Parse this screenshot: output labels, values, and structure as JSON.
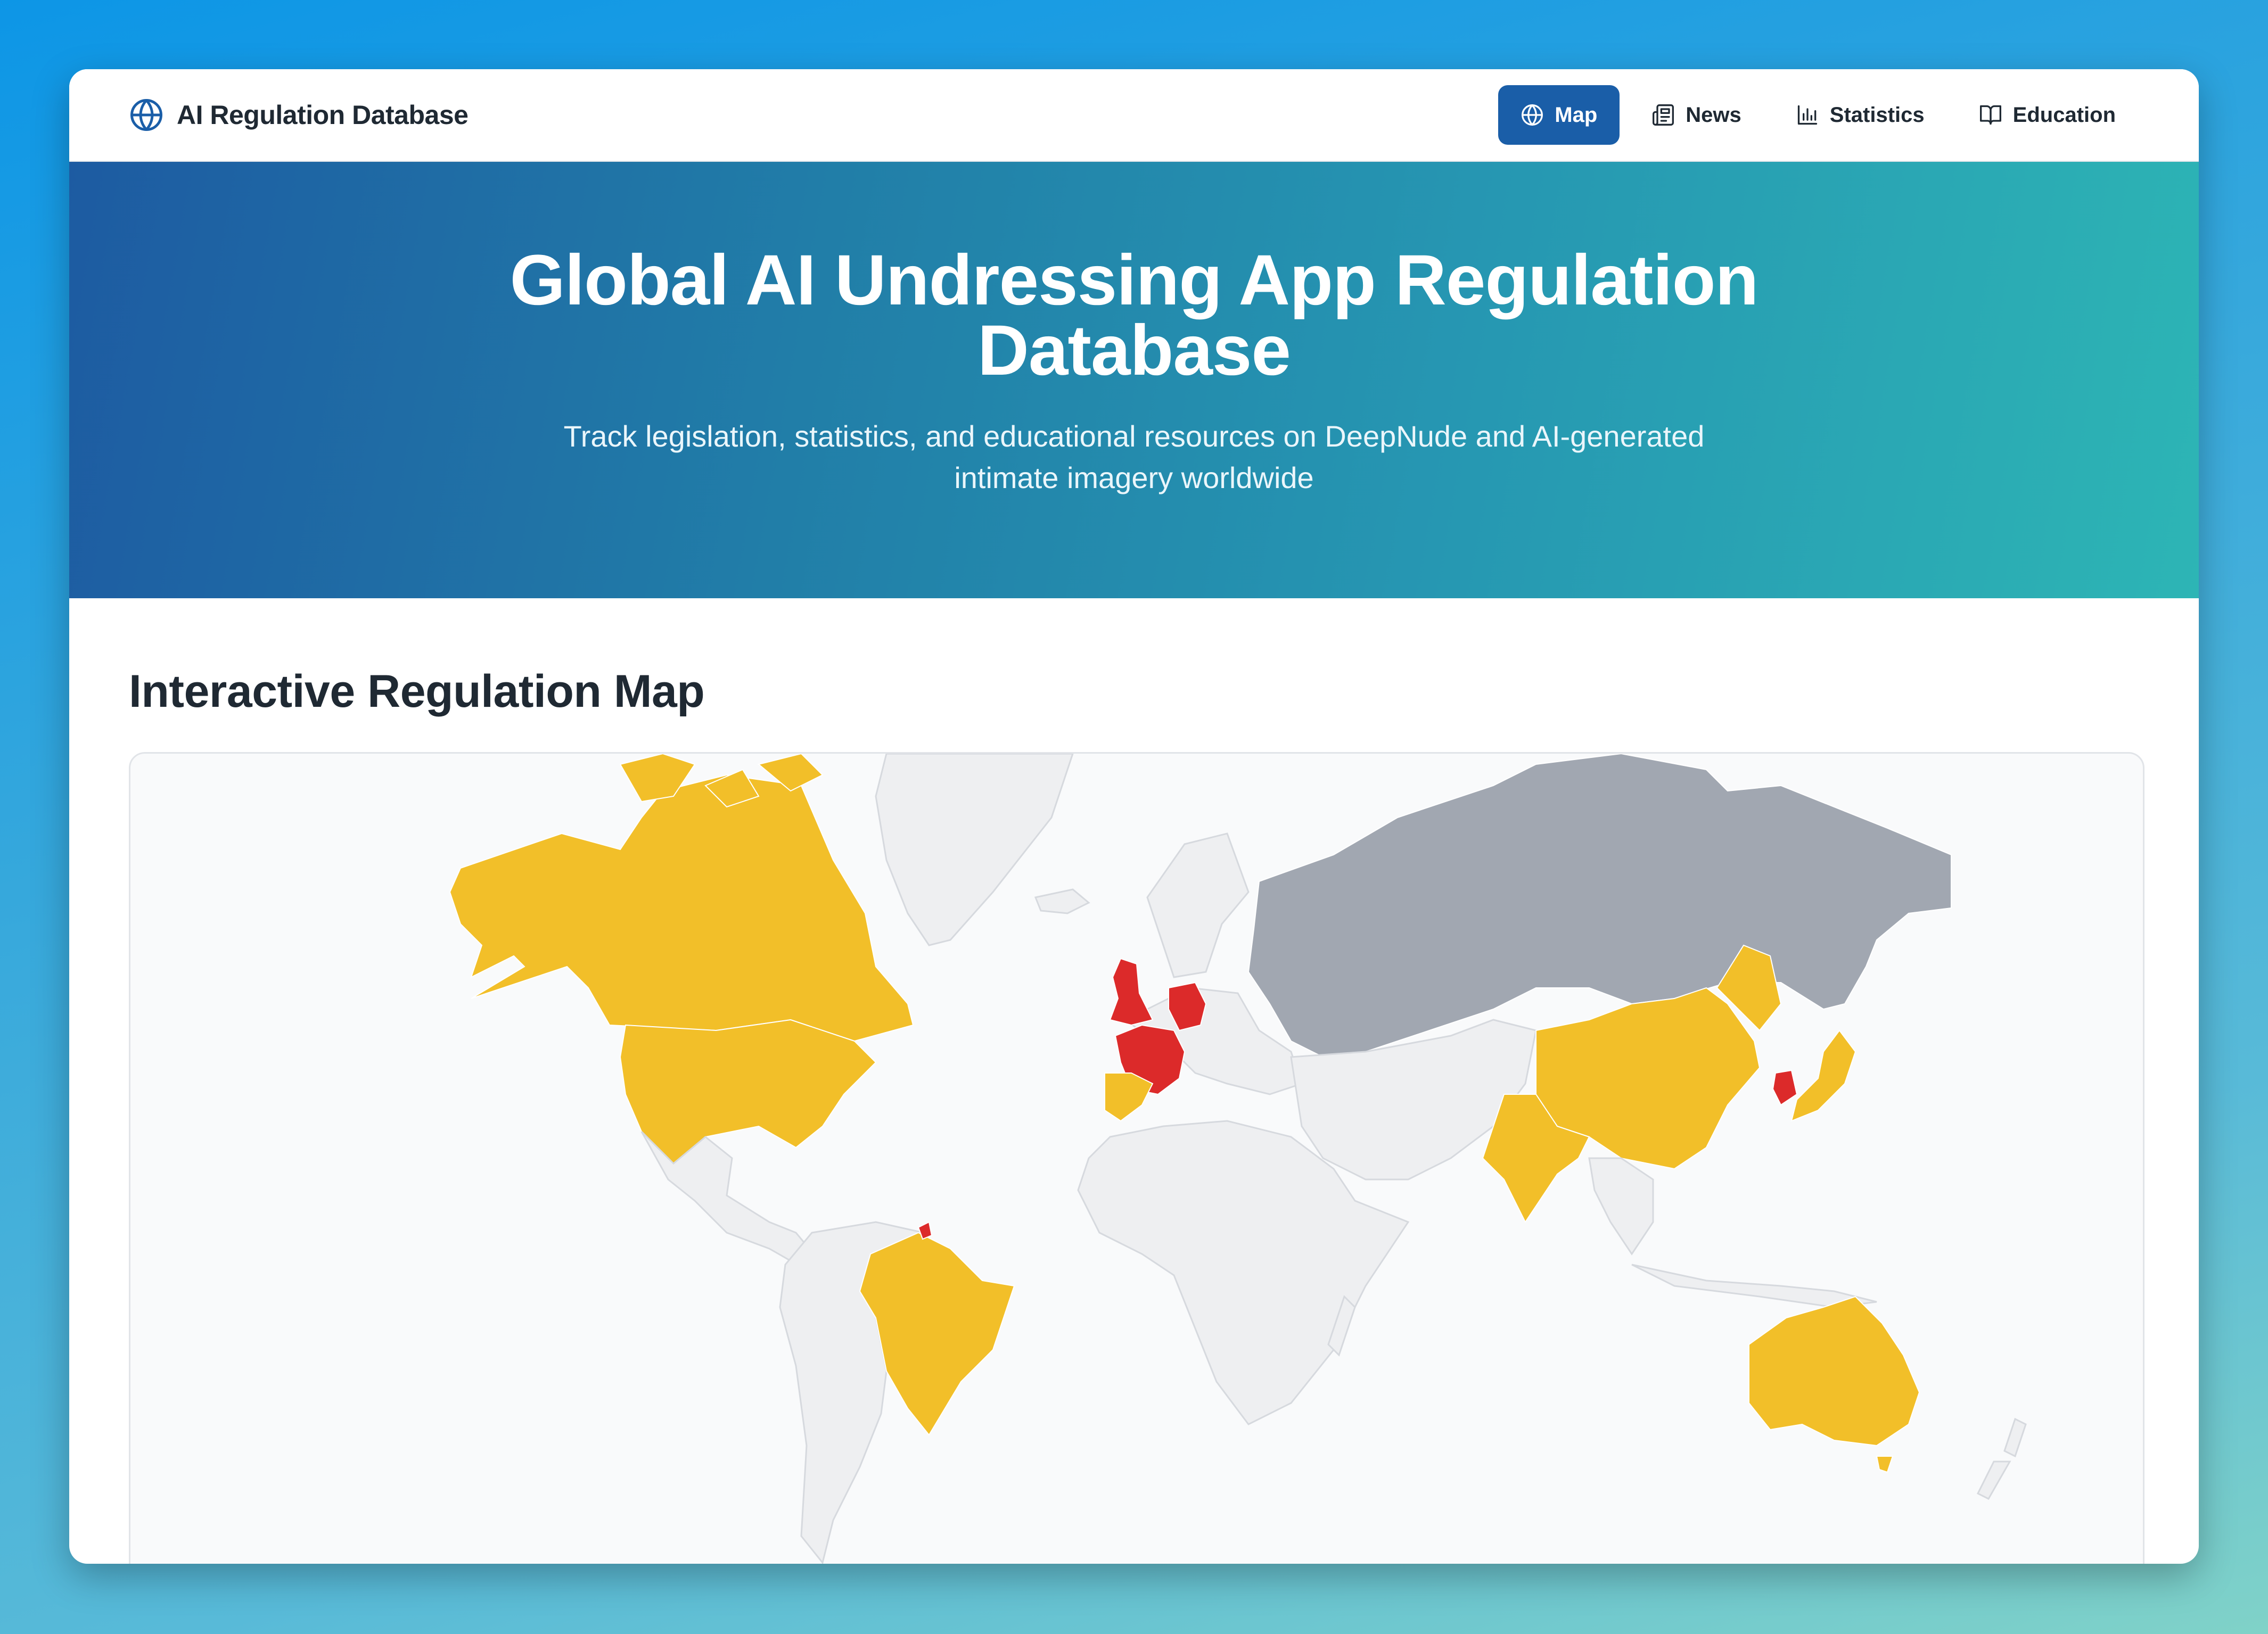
{
  "brand": {
    "title": "AI Regulation Database",
    "icon": "globe-icon"
  },
  "nav": {
    "items": [
      {
        "label": "Map",
        "icon": "globe-icon",
        "active": true
      },
      {
        "label": "News",
        "icon": "newspaper-icon",
        "active": false
      },
      {
        "label": "Statistics",
        "icon": "bar-chart-icon",
        "active": false
      },
      {
        "label": "Education",
        "icon": "book-open-icon",
        "active": false
      }
    ]
  },
  "hero": {
    "title": "Global AI Undressing App Regulation Database",
    "subtitle": "Track legislation, statistics, and educational resources on DeepNude and AI-generated intimate imagery worldwide"
  },
  "map_section": {
    "title": "Interactive Regulation Map"
  },
  "colors": {
    "accent": "#1a5ea8",
    "hero_gradient_start": "#1d5ba2",
    "hero_gradient_end": "#2db5b5",
    "status_yellow": "#f2bf29",
    "status_red": "#dc2a2a",
    "status_gray": "#a1a7b1",
    "no_data": "#eeeff1"
  }
}
